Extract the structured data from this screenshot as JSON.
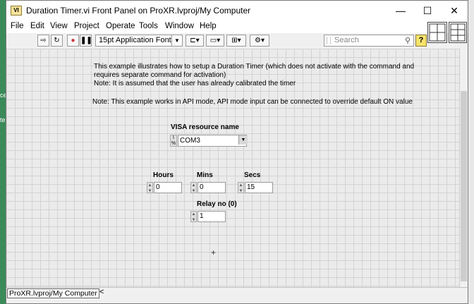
{
  "window": {
    "title": "Duration Timer.vi Front Panel on ProXR.lvproj/My Computer",
    "minimize": "—",
    "maximize": "☐",
    "close": "✕"
  },
  "menu": [
    "File",
    "Edit",
    "View",
    "Project",
    "Operate",
    "Tools",
    "Window",
    "Help"
  ],
  "toolbar": {
    "font": "15pt Application Font",
    "search_placeholder": "Search",
    "help": "?"
  },
  "panel": {
    "description_line1": "This example illustrates how to setup a Duration Timer (which does not activate with the command and",
    "description_line2": "requires separate command for activation)",
    "description_line3": "Note: It is assumed that the user has already calibrated the timer",
    "note": "Note: This example works in API mode, API mode input can be connected to override default ON value",
    "visa": {
      "label": "VISA resource name",
      "value": "COM3"
    },
    "hours": {
      "label": "Hours",
      "value": "0"
    },
    "mins": {
      "label": "Mins",
      "value": "0"
    },
    "secs": {
      "label": "Secs",
      "value": "15"
    },
    "relay": {
      "label": "Relay no (0)",
      "value": "1"
    }
  },
  "status": {
    "project": "ProXR.lvproj/My Computer",
    "scroll_left": "<"
  }
}
